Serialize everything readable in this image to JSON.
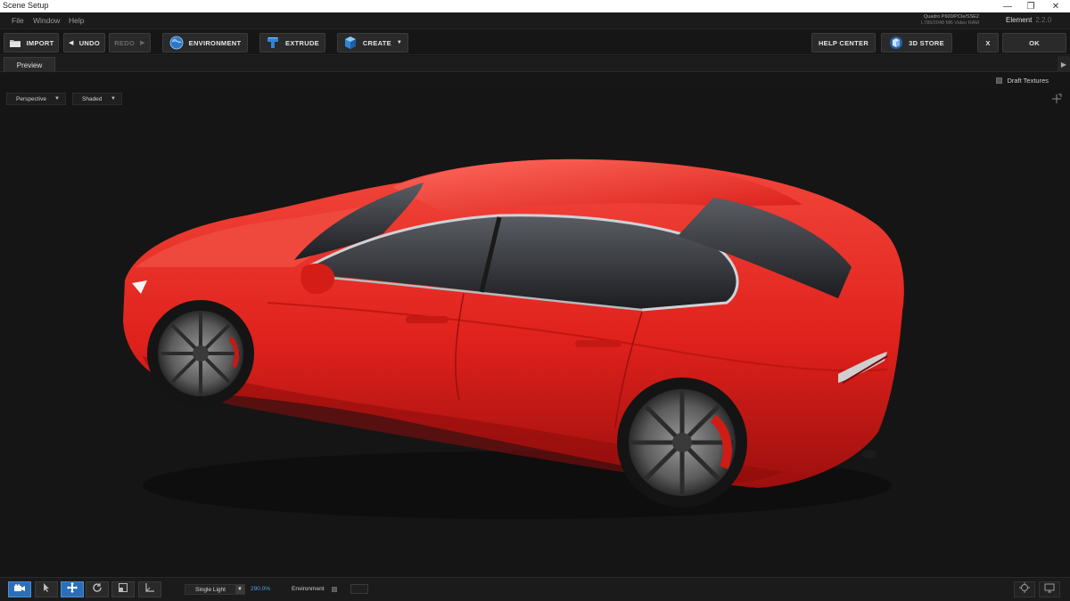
{
  "window": {
    "title": "Scene Setup"
  },
  "menu": [
    "File",
    "Window",
    "Help"
  ],
  "gpu_info": {
    "line1": "Quadro P600/PCIe/SSE2",
    "line2": "L789/2048 MB Video RAM"
  },
  "product": {
    "name": "Element",
    "version": "2.2.0"
  },
  "toolbar": {
    "import": "IMPORT",
    "undo": "UNDO",
    "redo": "REDO",
    "environment": "ENVIRONMENT",
    "extrude": "EXTRUDE",
    "create": "CREATE",
    "help_center": "HELP CENTER",
    "store": "3D STORE",
    "close": "X",
    "ok": "OK"
  },
  "tabs": {
    "preview": "Preview"
  },
  "draft_textures": {
    "label": "Draft Textures",
    "checked": false
  },
  "viewport": {
    "view_mode": "Perspective",
    "shading_mode": "Shaded",
    "car_color": "#e0211c"
  },
  "statusbar": {
    "light_preset": "Single Light",
    "percentage": "290.0%",
    "environment_label": "Environment",
    "accent_color": "#2d6fb7"
  }
}
